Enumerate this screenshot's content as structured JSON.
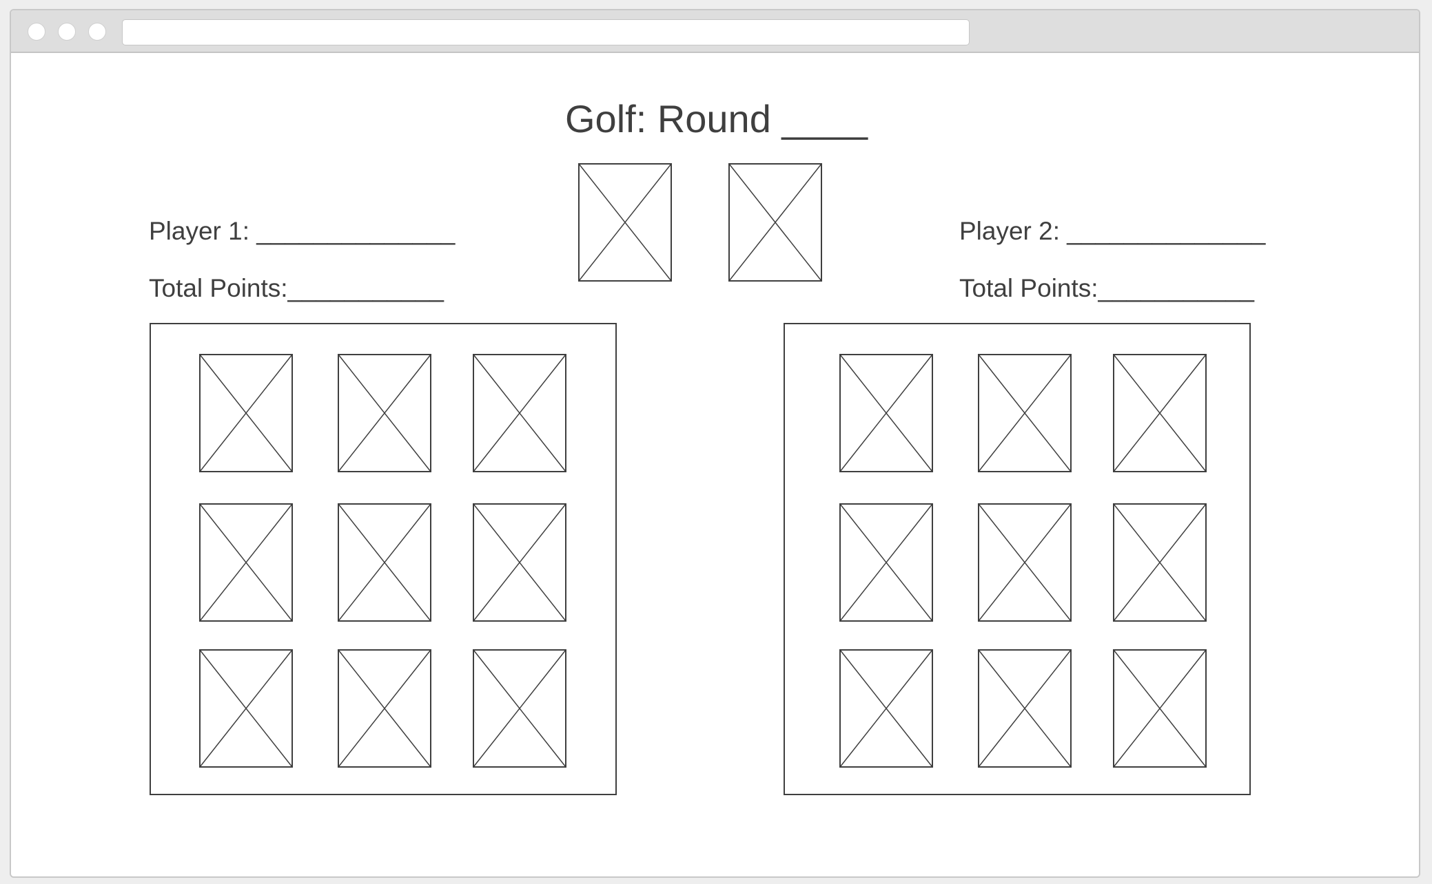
{
  "page": {
    "title": "Golf: Round ____"
  },
  "player1": {
    "name_label": "Player 1: ______________",
    "points_label": "Total Points:___________"
  },
  "player2": {
    "name_label": "Player 2: ______________",
    "points_label": "Total Points:___________"
  },
  "deck": {
    "cards": [
      "draw-pile",
      "discard-pile"
    ]
  },
  "colors": {
    "stroke": "#3f3f3f",
    "chrome": "#dedede"
  }
}
